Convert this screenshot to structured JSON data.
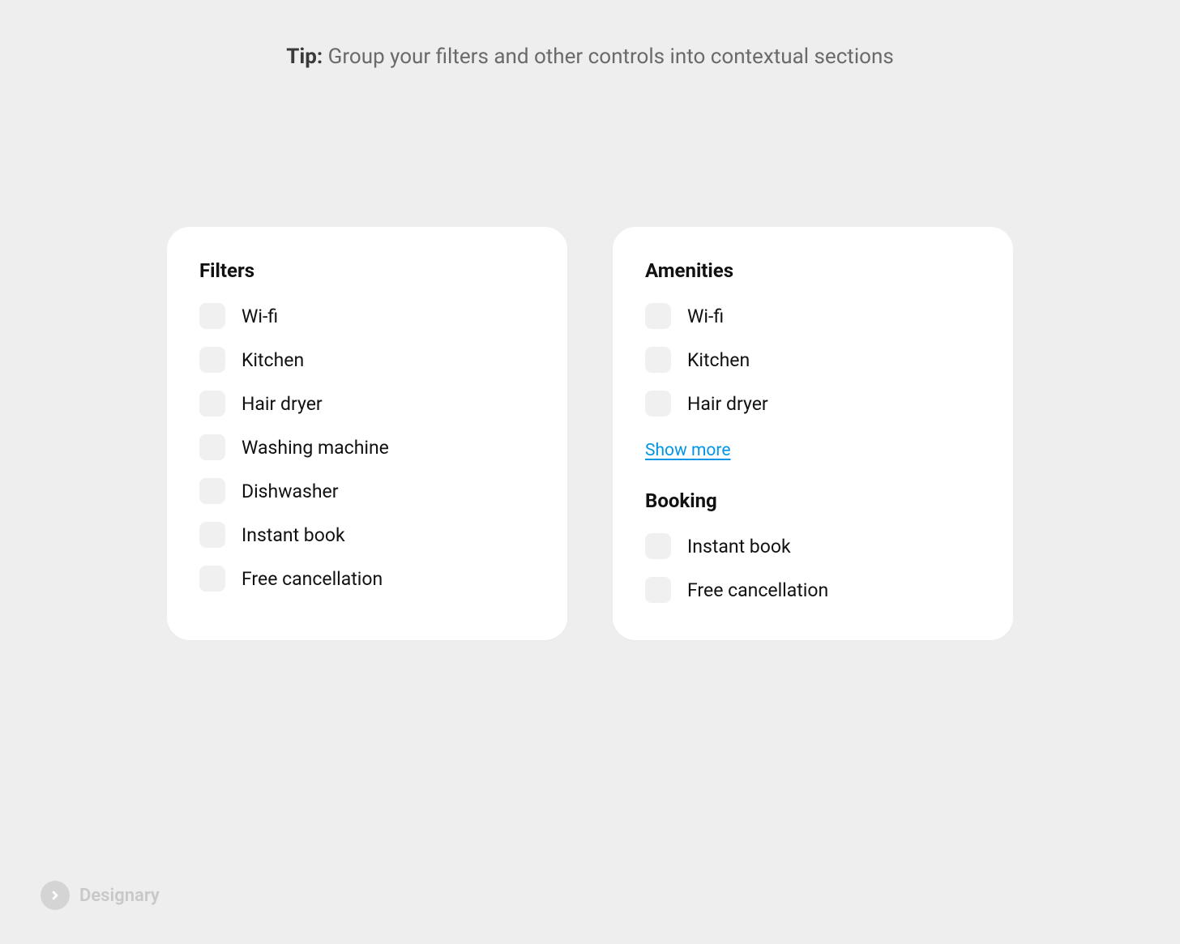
{
  "tip": {
    "prefix": "Tip:",
    "text": "Group your filters and other controls into contextual sections"
  },
  "leftCard": {
    "title": "Filters",
    "items": [
      {
        "label": "Wi-fi"
      },
      {
        "label": "Kitchen"
      },
      {
        "label": "Hair dryer"
      },
      {
        "label": "Washing machine"
      },
      {
        "label": "Dishwasher"
      },
      {
        "label": "Instant book"
      },
      {
        "label": "Free cancellation"
      }
    ]
  },
  "rightCard": {
    "amenities": {
      "title": "Amenities",
      "items": [
        {
          "label": "Wi-fi"
        },
        {
          "label": "Kitchen"
        },
        {
          "label": "Hair dryer"
        }
      ],
      "showMore": "Show more"
    },
    "booking": {
      "title": "Booking",
      "items": [
        {
          "label": "Instant book"
        },
        {
          "label": "Free cancellation"
        }
      ]
    }
  },
  "brand": {
    "name": "Designary"
  }
}
